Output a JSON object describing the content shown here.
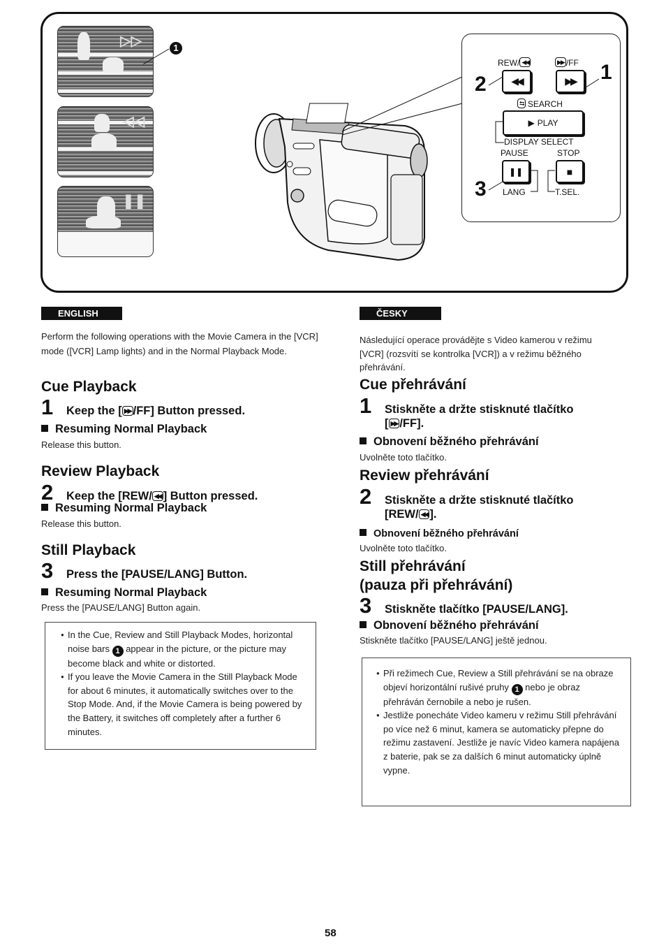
{
  "figure": {
    "callout_marker": "1",
    "panel": {
      "rew_label": "REW/",
      "ff_label": "/FF",
      "search_label": "SEARCH",
      "play_label": "PLAY",
      "display_select_label": "DISPLAY SELECT",
      "pause_label": "PAUSE",
      "stop_label": "STOP",
      "lang_label": "LANG",
      "tsel_label": "T.SEL.",
      "num_1": "1",
      "num_2": "2",
      "num_3": "3",
      "rew_icon": "◀◀",
      "ff_icon": "▶▶",
      "play_icon": "▶",
      "pause_icon": "❚❚",
      "stop_icon": "■",
      "small_rew_icon": "◀◀",
      "small_ff_icon": "▶▶",
      "search_icon": "⇆"
    }
  },
  "english": {
    "lang_label": "ENGLISH",
    "intro": "Perform the following operations with the Movie Camera in the [VCR] mode ([VCR] Lamp lights) and in the Normal Playback Mode.",
    "cue": {
      "title": "Cue Playback",
      "step_num": "1",
      "step_pre": "Keep the [",
      "step_icon": "▶▶",
      "step_post": "/FF] Button pressed.",
      "resume_title": "Resuming Normal Playback",
      "resume_text": "Release this button."
    },
    "review": {
      "title": "Review Playback",
      "step_num": "2",
      "step_pre": "Keep the [REW/",
      "step_icon": "◀◀",
      "step_post": "] Button pressed.",
      "resume_title": "Resuming Normal Playback",
      "resume_text": "Release this button."
    },
    "still": {
      "title": "Still Playback",
      "step_num": "3",
      "step_text": "Press the [PAUSE/LANG] Button.",
      "resume_title": "Resuming Normal Playback",
      "resume_text": "Press the [PAUSE/LANG] Button again."
    },
    "notes": {
      "note1_pre": "In the Cue, Review and Still Playback Modes, horizontal noise bars ",
      "note1_marker": "1",
      "note1_post": " appear in the picture, or the picture may become black and white or distorted.",
      "note2": "If you leave the Movie Camera in the Still Playback Mode for about 6 minutes, it automatically switches over to the Stop Mode. And, if the Movie Camera is being powered by the Battery, it switches off completely after a further 6 minutes."
    }
  },
  "czech": {
    "lang_label": "ČESKY",
    "intro": "Následující operace provádějte s Video kamerou v režimu [VCR] (rozsvítí se kontrolka [VCR]) a v režimu běžného přehrávání.",
    "cue": {
      "title": "Cue přehrávání",
      "step_num": "1",
      "step_line1": "Stiskněte a držte stisknuté tlačítko",
      "step_pre": "[",
      "step_icon": "▶▶",
      "step_post": "/FF].",
      "resume_title": "Obnovení běžného přehrávání",
      "resume_text": "Uvolněte toto tlačítko."
    },
    "review": {
      "title": "Review přehrávání",
      "step_num": "2",
      "step_line1": "Stiskněte a držte stisknuté tlačítko",
      "step_pre": "[REW/",
      "step_icon": "◀◀",
      "step_post": "].",
      "resume_title": "Obnovení běžného přehrávání",
      "resume_text": "Uvolněte toto tlačítko."
    },
    "still": {
      "title_line1": "Still přehrávání",
      "title_line2": "(pauza při přehrávání)",
      "step_num": "3",
      "step_text": "Stiskněte tlačítko [PAUSE/LANG].",
      "resume_title": "Obnovení běžného přehrávání",
      "resume_text": "Stiskněte tlačítko [PAUSE/LANG] ještě jednou."
    },
    "notes": {
      "note1_pre": "Při režimech Cue, Review a Still přehrávání se na obraze objeví horizontální rušivé pruhy ",
      "note1_marker": "1",
      "note1_post": " nebo je obraz přehráván černobile a nebo je rušen.",
      "note2": "Jestliže ponecháte Video kameru v režimu Still přehrávání po více než 6 minut, kamera se automaticky přepne do režimu zastavení. Jestliže je navíc Video kamera napájena z baterie, pak se za dalších 6 minut automaticky úplně vypne."
    }
  },
  "page_number": "58"
}
